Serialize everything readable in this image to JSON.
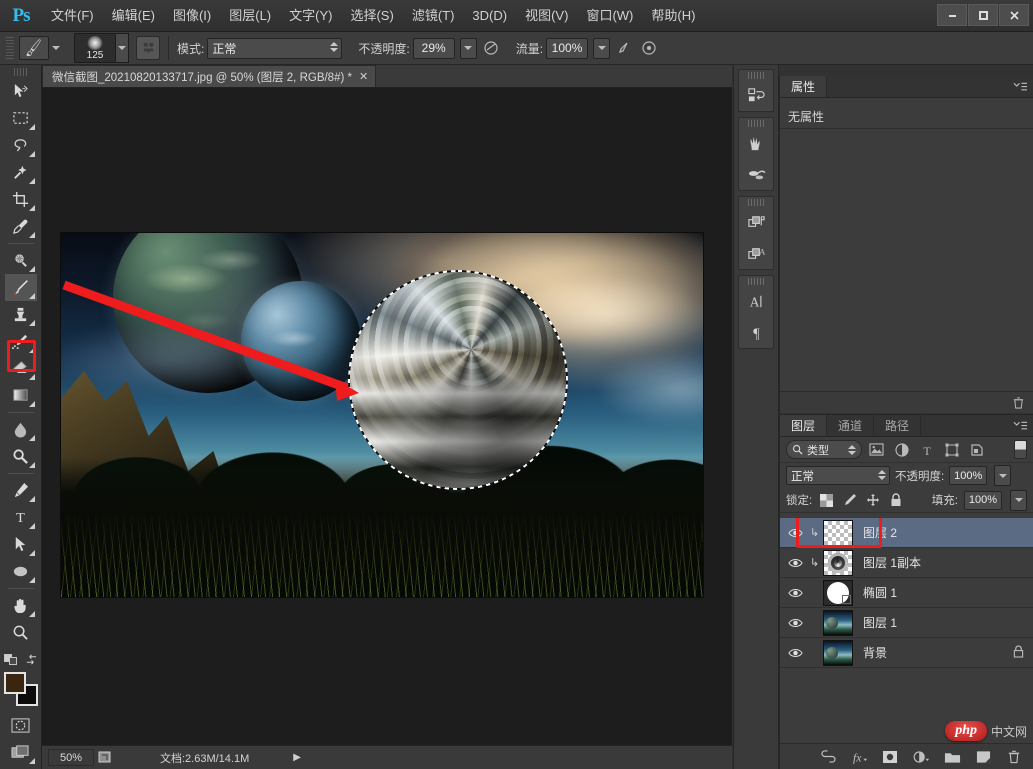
{
  "app": {
    "name": "Ps",
    "logo_color": "#36bdf0"
  },
  "window_controls": {
    "minimize": "—",
    "maximize": "❐",
    "close": "✕"
  },
  "menubar": [
    {
      "label": "文件(F)"
    },
    {
      "label": "编辑(E)"
    },
    {
      "label": "图像(I)"
    },
    {
      "label": "图层(L)"
    },
    {
      "label": "文字(Y)"
    },
    {
      "label": "选择(S)"
    },
    {
      "label": "滤镜(T)"
    },
    {
      "label": "3D(D)"
    },
    {
      "label": "视图(V)"
    },
    {
      "label": "窗口(W)"
    },
    {
      "label": "帮助(H)"
    }
  ],
  "options_bar": {
    "brush_size": "125",
    "mode_label": "模式:",
    "mode_value": "正常",
    "opacity_label": "不透明度:",
    "opacity_value": "29%",
    "flow_label": "流量:",
    "flow_value": "100%"
  },
  "toolbar": {
    "tools": [
      {
        "name": "move-tool",
        "title": "移动工具"
      },
      {
        "name": "marquee-tool",
        "title": "矩形选框工具"
      },
      {
        "name": "lasso-tool",
        "title": "套索工具"
      },
      {
        "name": "magic-wand-tool",
        "title": "魔棒工具"
      },
      {
        "name": "crop-tool",
        "title": "裁剪工具"
      },
      {
        "name": "eyedropper-tool",
        "title": "吸管工具"
      },
      {
        "name": "spot-healing-tool",
        "title": "污点修复画笔工具"
      },
      {
        "name": "brush-tool",
        "title": "画笔工具"
      },
      {
        "name": "clone-stamp-tool",
        "title": "仿制图章工具"
      },
      {
        "name": "history-brush-tool",
        "title": "历史记录画笔工具"
      },
      {
        "name": "eraser-tool",
        "title": "橡皮擦工具"
      },
      {
        "name": "gradient-tool",
        "title": "渐变工具"
      },
      {
        "name": "blur-tool",
        "title": "模糊工具"
      },
      {
        "name": "dodge-tool",
        "title": "减淡工具"
      },
      {
        "name": "pen-tool",
        "title": "钢笔工具"
      },
      {
        "name": "type-tool",
        "title": "横排文字工具"
      },
      {
        "name": "path-selection-tool",
        "title": "路径选择工具"
      },
      {
        "name": "ellipse-tool",
        "title": "椭圆工具"
      },
      {
        "name": "hand-tool",
        "title": "抓手工具"
      },
      {
        "name": "zoom-tool",
        "title": "缩放工具"
      }
    ],
    "active_tool": "brush-tool",
    "highlight_color": "#ee1c1c",
    "foreground_color": "#3a2510",
    "background_color": "#0b0b0b"
  },
  "document": {
    "tab_title": "微信截图_20210820133717.jpg @ 50% (图层 2, RGB/8#) *",
    "close_glyph": "✕"
  },
  "status_bar": {
    "zoom": "50%",
    "doc_info": "文档:2.63M/14.1M",
    "arrow": "▶"
  },
  "icon_dock": {
    "icons": [
      {
        "name": "history-panel-icon"
      },
      {
        "name": "brush-presets-icon"
      },
      {
        "name": "clone-source-icon"
      },
      {
        "name": "layer-comps-icon"
      },
      {
        "name": "adjustments-icon"
      },
      {
        "name": "character-panel-icon"
      },
      {
        "name": "paragraph-panel-icon"
      }
    ]
  },
  "properties_panel": {
    "tab_label": "属性",
    "empty_text": "无属性"
  },
  "layers_panel": {
    "tabs": [
      {
        "label": "图层",
        "active": true
      },
      {
        "label": "通道",
        "active": false
      },
      {
        "label": "路径",
        "active": false
      }
    ],
    "filter": {
      "kind_label": "类型",
      "icons": [
        "pixel-filter-icon",
        "adjustment-filter-icon",
        "type-filter-icon",
        "shape-filter-icon",
        "smart-object-filter-icon"
      ]
    },
    "blend_mode": "正常",
    "opacity_label": "不透明度:",
    "opacity_value": "100%",
    "lock_label": "锁定:",
    "fill_label": "填充:",
    "fill_value": "100%",
    "layers": [
      {
        "name": "图层 2",
        "thumb": "checker",
        "clipped": true,
        "selected": true,
        "locked": false,
        "visible": true
      },
      {
        "name": "图层 1副本",
        "thumb": "checker-swirl",
        "clipped": true,
        "selected": false,
        "locked": false,
        "visible": true
      },
      {
        "name": "椭圆 1",
        "thumb": "shape-oval",
        "clipped": false,
        "selected": false,
        "locked": false,
        "visible": true
      },
      {
        "name": "图层 1",
        "thumb": "photo",
        "clipped": false,
        "selected": false,
        "locked": false,
        "visible": true
      },
      {
        "name": "背景",
        "thumb": "photo",
        "clipped": false,
        "selected": false,
        "locked": true,
        "visible": true
      }
    ],
    "bottom_icons": [
      "link-layers-icon",
      "layer-style-fx-icon",
      "add-mask-icon",
      "adjustment-layer-icon",
      "new-group-icon",
      "new-layer-icon",
      "delete-layer-icon"
    ],
    "highlight_color": "#ee1c1c"
  },
  "watermark": {
    "brand": "php",
    "site": "中文网"
  },
  "canvas": {
    "annotation_arrow_color": "#ee1c1c",
    "selection": "marching-ants-ellipse"
  }
}
